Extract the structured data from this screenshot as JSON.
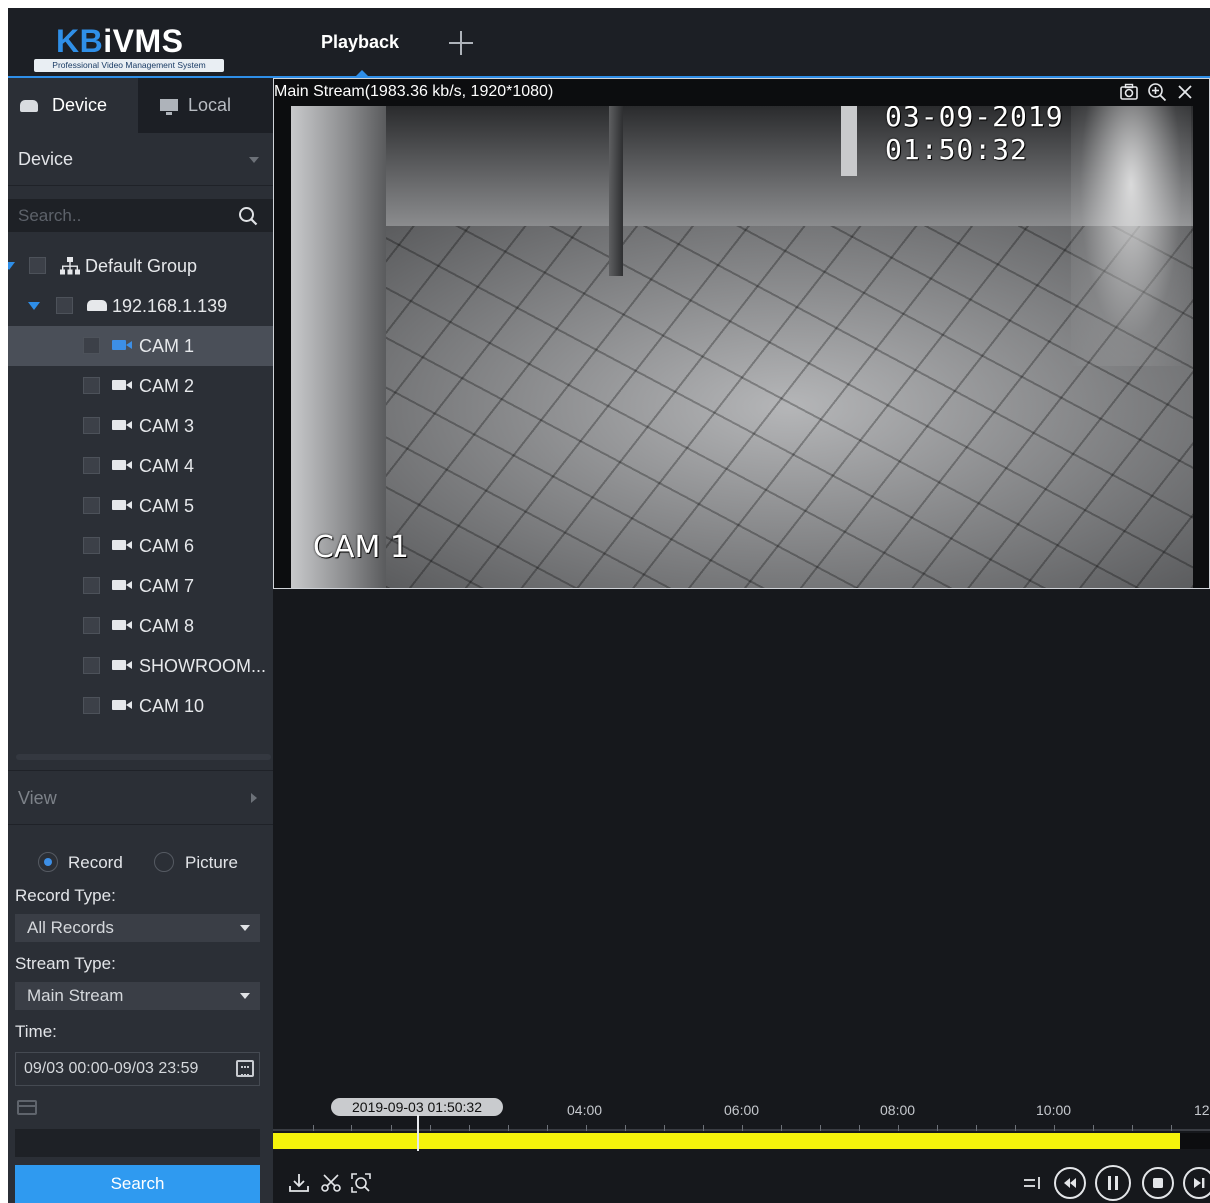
{
  "app": {
    "logo_brand_kb": "KB",
    "logo_brand_ivms": "iVMS",
    "logo_tagline": "Professional Video Management System",
    "accent_color": "#2e8ee8"
  },
  "tabs": {
    "active_label": "Playback",
    "add_icon": "plus-icon"
  },
  "source_tabs": {
    "device": "Device",
    "local": "Local"
  },
  "device_dropdown": "Device",
  "search": {
    "placeholder": "Search.."
  },
  "tree": {
    "group": "Default Group",
    "device": "192.168.1.139",
    "cameras": [
      "CAM 1",
      "CAM 2",
      "CAM 3",
      "CAM 4",
      "CAM 5",
      "CAM 6",
      "CAM 7",
      "CAM 8",
      "SHOWROOM...",
      "CAM 10"
    ],
    "selected_camera": "CAM 1"
  },
  "view_section": "View",
  "form": {
    "radio_record": "Record",
    "radio_picture": "Picture",
    "selected_radio": "Record",
    "record_type_label": "Record Type:",
    "record_type_value": "All Records",
    "stream_type_label": "Stream Type:",
    "stream_type_value": "Main Stream",
    "time_label": "Time:",
    "time_value": "09/03 00:00-09/03 23:59",
    "search_button": "Search"
  },
  "video": {
    "stream_info": "Main Stream(1983.36 kb/s, 1920*1080)",
    "osd_timestamp": "03-09-2019 01:50:32",
    "osd_camera": "CAM 1"
  },
  "timeline": {
    "current": "2019-09-03 01:50:32",
    "ticks": [
      "04:00",
      "06:00",
      "08:00",
      "10:00",
      "12"
    ],
    "record_color": "#f5f30b"
  }
}
